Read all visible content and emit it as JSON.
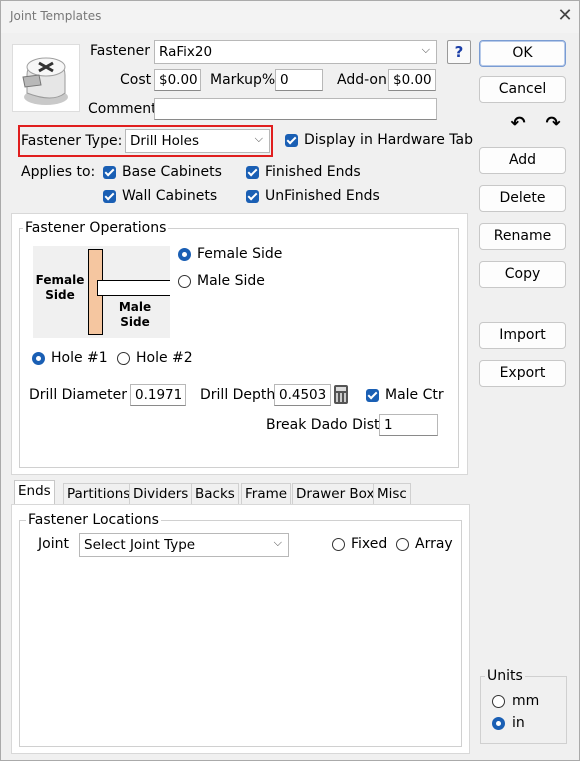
{
  "window": {
    "title": "Joint Templates"
  },
  "fastener": {
    "label": "Fastener",
    "value": "RaFix20",
    "help": "?",
    "cost_label": "Cost",
    "cost_value": "$0.00",
    "markup_label": "Markup%",
    "markup_value": "0",
    "addon_label": "Add-on",
    "addon_value": "$0.00",
    "comment_label": "Comment",
    "comment_value": "",
    "type_label": "Fastener Type:",
    "type_value": "Drill Holes",
    "display_hw_label": "Display in Hardware Tab",
    "display_hw_checked": true,
    "highlight_color": "#e01e1e"
  },
  "applies_to": {
    "label": "Applies to:",
    "base_cabinets": "Base Cabinets",
    "wall_cabinets": "Wall Cabinets",
    "finished_ends": "Finished Ends",
    "unfinished_ends": "UnFinished Ends"
  },
  "operations": {
    "title": "Fastener Operations",
    "diagram_female": "Female Side",
    "diagram_male": "Male Side",
    "female_side": "Female Side",
    "male_side": "Male Side",
    "side_selected": "female",
    "hole1": "Hole #1",
    "hole2": "Hole #2",
    "hole_selected": "1",
    "drill_diameter_label": "Drill Diameter",
    "drill_diameter_value": "0.1971",
    "drill_depth_label": "Drill Depth",
    "drill_depth_value": "0.4503",
    "male_ctr_label": "Male Ctr",
    "break_dado_label": "Break Dado Dist.",
    "break_dado_value": "1"
  },
  "tabs": [
    "Ends",
    "Partitions",
    "Dividers",
    "Backs",
    "Frame",
    "Drawer Box",
    "Misc"
  ],
  "active_tab": "Ends",
  "locations": {
    "title": "Fastener Locations",
    "joint_label": "Joint",
    "joint_value": "Select Joint Type",
    "fixed_label": "Fixed",
    "array_label": "Array"
  },
  "buttons": {
    "ok": "OK",
    "cancel": "Cancel",
    "add": "Add",
    "delete": "Delete",
    "rename": "Rename",
    "copy": "Copy",
    "import": "Import",
    "export": "Export"
  },
  "units": {
    "title": "Units",
    "mm": "mm",
    "in": "in",
    "selected": "in"
  },
  "colors": {
    "accent": "#1a5fb4",
    "board": "#f5c6a0"
  }
}
